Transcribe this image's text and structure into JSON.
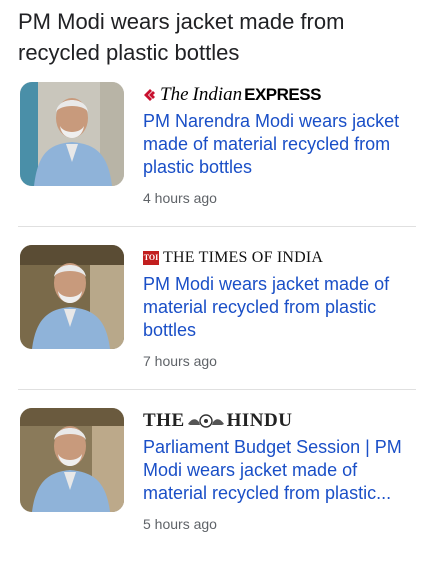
{
  "headline": "PM Modi wears jacket made from recycled plastic bottles",
  "articles": [
    {
      "source_parts": [
        "The",
        "Indian",
        "EXPRESS"
      ],
      "title": "PM Narendra Modi wears jacket made of material recycled from plastic bottles",
      "time": "4 hours ago"
    },
    {
      "source_badge": "TOI",
      "source_name": "THE TIMES OF INDIA",
      "title": "PM Modi wears jacket made of material recycled from plastic bottles",
      "time": "7 hours ago"
    },
    {
      "source_parts": [
        "THE",
        "HINDU"
      ],
      "title": "Parliament Budget Session | PM Modi wears jacket made of material recycled from plastic...",
      "time": "5 hours ago"
    }
  ],
  "colors": {
    "link": "#1a4fc7",
    "text": "#202124",
    "meta": "#5f6368",
    "toi_red": "#c21f1f",
    "ie_red": "#c8102e",
    "jacket": "#8fb3d9"
  }
}
